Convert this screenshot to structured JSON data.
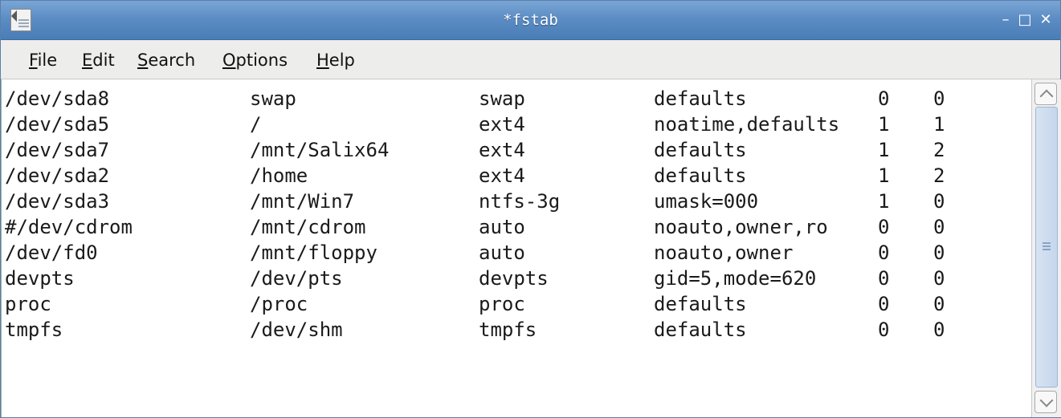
{
  "window": {
    "title": "*fstab",
    "controls": {
      "minimize": "–",
      "maximize": "□",
      "close": "✕"
    }
  },
  "menu": [
    {
      "label": "File"
    },
    {
      "label": "Edit"
    },
    {
      "label": "Search"
    },
    {
      "label": "Options"
    },
    {
      "label": "Help"
    }
  ],
  "editor": {
    "rows": [
      [
        "/dev/sda8",
        "swap",
        "swap",
        "defaults",
        "0",
        "0"
      ],
      [
        "/dev/sda5",
        "/",
        "ext4",
        "noatime,defaults",
        "1",
        "1"
      ],
      [
        "/dev/sda7",
        "/mnt/Salix64",
        "ext4",
        "defaults",
        "1",
        "2"
      ],
      [
        "/dev/sda2",
        "/home",
        "ext4",
        "defaults",
        "1",
        "2"
      ],
      [
        "/dev/sda3",
        "/mnt/Win7",
        "ntfs-3g",
        "umask=000",
        "1",
        "0"
      ],
      [
        "#/dev/cdrom",
        "/mnt/cdrom",
        "auto",
        "noauto,owner,ro",
        "0",
        "0"
      ],
      [
        "/dev/fd0",
        "/mnt/floppy",
        "auto",
        "noauto,owner",
        "0",
        "0"
      ],
      [
        "devpts",
        "/dev/pts",
        "devpts",
        "gid=5,mode=620",
        "0",
        "0"
      ],
      [
        "proc",
        "/proc",
        "proc",
        "defaults",
        "0",
        "0"
      ],
      [
        "tmpfs",
        "/dev/shm",
        "tmpfs",
        "defaults",
        "0",
        "0"
      ]
    ]
  },
  "icons": {
    "app": "text-editor-icon"
  },
  "colors": {
    "titlebar": "#5c8dc4",
    "menubar": "#ededec",
    "scroll_track": "#c5d6ec"
  }
}
